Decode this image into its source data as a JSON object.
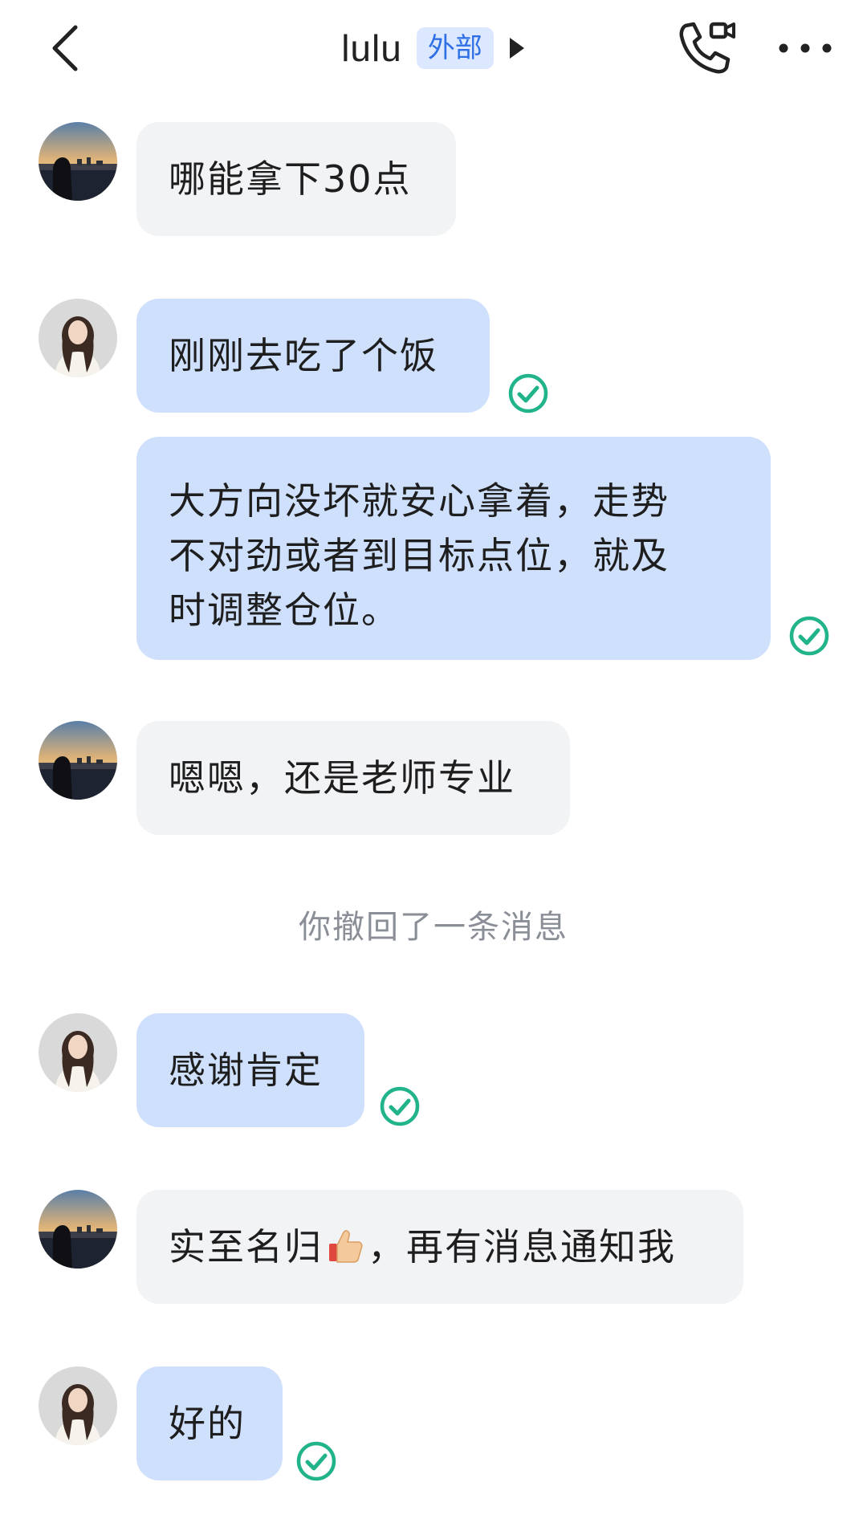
{
  "header": {
    "contact_name": "lulu",
    "badge": "外部"
  },
  "messages": [
    {
      "side": "in",
      "avatar": "sunset-avatar",
      "text": "哪能拿下30点"
    },
    {
      "side": "out",
      "avatar": "woman-avatar",
      "text": "刚刚去吃了个饭",
      "status": "read"
    },
    {
      "side": "out",
      "avatar": null,
      "lines": [
        "大方向没坏就安心拿着，走势",
        "不对劲或者到目标点位，就及",
        "时调整仓位。"
      ],
      "status": "read"
    },
    {
      "side": "in",
      "avatar": "sunset-avatar",
      "text": "嗯嗯，还是老师专业"
    },
    {
      "side": "out",
      "avatar": "woman-avatar",
      "text": "感谢肯定",
      "status": "read"
    },
    {
      "side": "in",
      "avatar": "sunset-avatar",
      "text_before": "实至名归",
      "emoji": "thumbs-up-icon",
      "text_after": "，再有消息通知我"
    },
    {
      "side": "out",
      "avatar": "woman-avatar",
      "text": "好的",
      "status": "read"
    }
  ],
  "system_notice": "你撤回了一条消息",
  "colors": {
    "incoming_bubble": "#f2f3f5",
    "outgoing_bubble": "#cfe0fd",
    "read_check": "#21b38a",
    "badge_text": "#2f6fe6",
    "badge_bg": "#dce8ff"
  }
}
